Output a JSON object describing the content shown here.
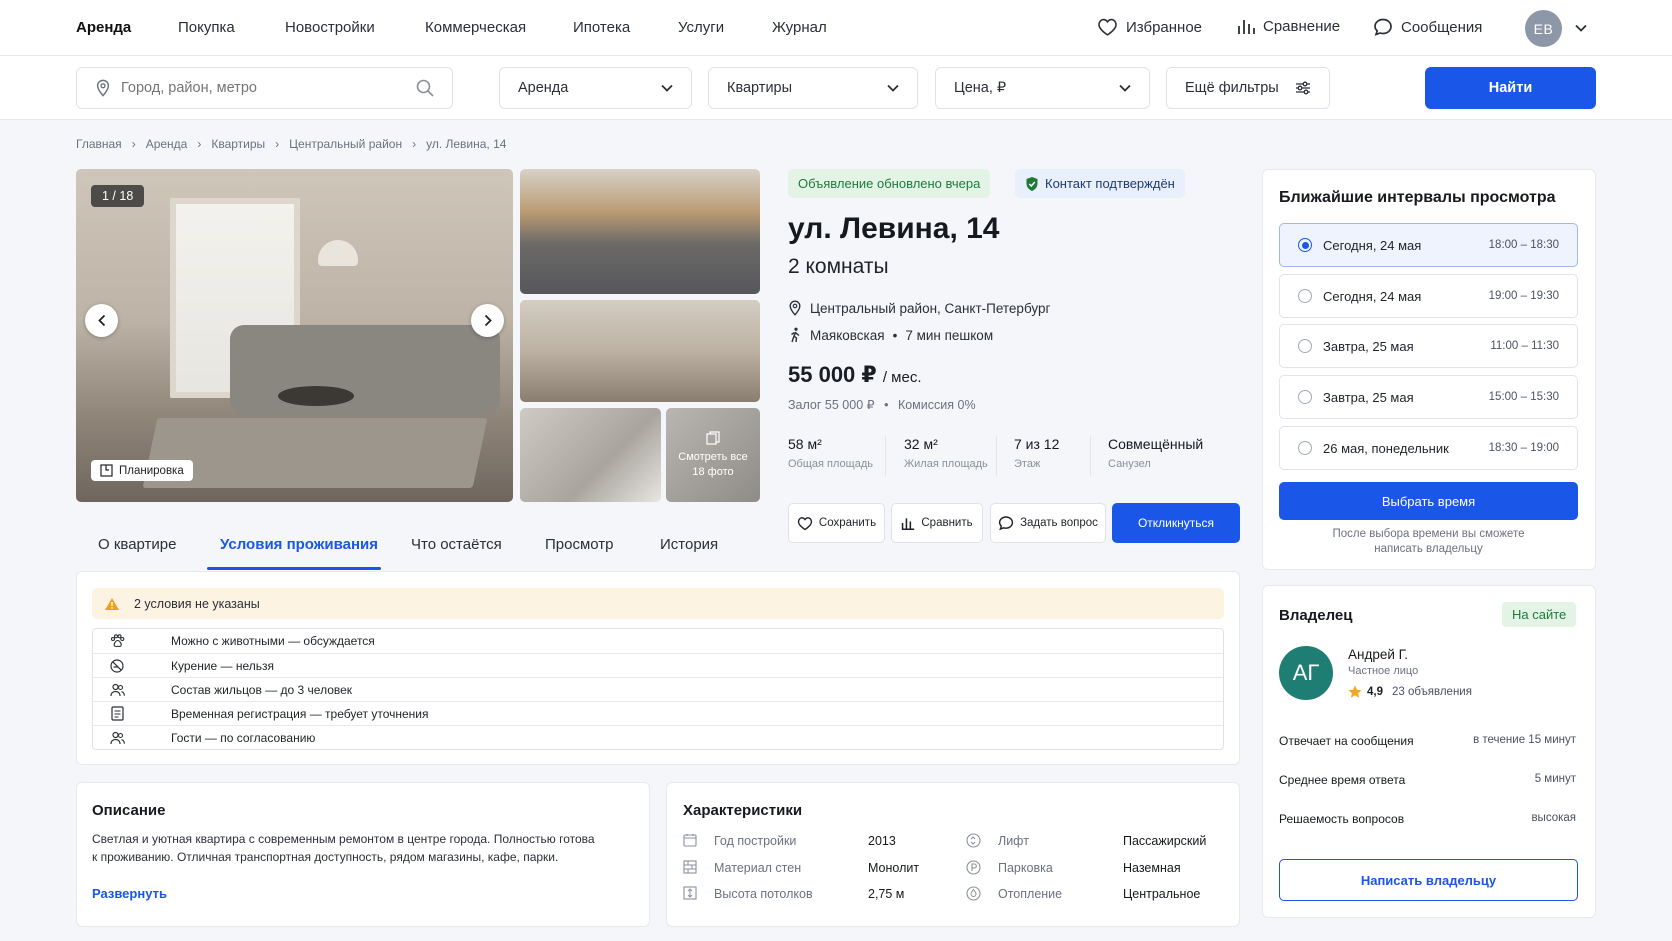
{
  "nav": {
    "items": [
      "Аренда",
      "Покупка",
      "Новостройки",
      "Коммерческая",
      "Ипотека",
      "Услуги",
      "Журнал"
    ],
    "favorites": "Избранное",
    "compare": "Сравнение",
    "messages": "Сообщения",
    "avatar": "ЕВ"
  },
  "filters": {
    "search_placeholder": "Город, район, метро",
    "deal": "Аренда",
    "type": "Квартиры",
    "price": "Цена, ₽",
    "more": "Ещё фильтры",
    "find": "Найти"
  },
  "breadcrumbs": [
    "Главная",
    "Аренда",
    "Квартиры",
    "Центральный район",
    "ул. Левина, 14"
  ],
  "gallery": {
    "counter": "1 / 18",
    "plan": "Планировка",
    "more_line1": "Смотреть все",
    "more_line2": "18 фото"
  },
  "listing": {
    "updated": "Объявление обновлено вчера",
    "verified": "Контакт подтверждён",
    "title": "ул. Левина, 14",
    "rooms": "2 комнаты",
    "district": "Центральный район, Санкт-Петербург",
    "metro": "Маяковская",
    "walk": "7 мин пешком",
    "price": "55 000 ₽",
    "per": "/ мес.",
    "deposit": "Залог 55 000 ₽",
    "commission": "Комиссия 0%",
    "specs": [
      {
        "value": "58 м²",
        "label": "Общая площадь"
      },
      {
        "value": "32 м²",
        "label": "Жилая площадь"
      },
      {
        "value": "7 из 12",
        "label": "Этаж"
      },
      {
        "value": "Совмещённый",
        "label": "Санузел"
      }
    ],
    "actions": {
      "save": "Сохранить",
      "compare": "Сравнить",
      "ask": "Задать вопрос",
      "respond": "Откликнуться"
    }
  },
  "tabs": [
    "О квартире",
    "Условия проживания",
    "Что остаётся",
    "Просмотр",
    "История"
  ],
  "conditions": {
    "warning": "2 условия не указаны",
    "rows": [
      "Можно с животными — обсуждается",
      "Курение — нельзя",
      "Состав жильцов — до 3 человек",
      "Временная регистрация — требует уточнения",
      "Гости — по согласованию"
    ]
  },
  "description": {
    "title": "Описание",
    "line1": "Светлая и уютная квартира с современным ремонтом в центре города. Полностью готова",
    "line2": "к проживанию. Отличная транспортная доступность, рядом магазины, кафе, парки.",
    "expand": "Развернуть"
  },
  "characteristics": {
    "title": "Характеристики",
    "left": [
      {
        "label": "Год постройки",
        "value": "2013"
      },
      {
        "label": "Материал стен",
        "value": "Монолит"
      },
      {
        "label": "Высота потолков",
        "value": "2,75 м"
      }
    ],
    "right": [
      {
        "label": "Лифт",
        "value": "Пассажирский"
      },
      {
        "label": "Парковка",
        "value": "Наземная"
      },
      {
        "label": "Отопление",
        "value": "Центральное"
      }
    ]
  },
  "viewing": {
    "title": "Ближайшие интервалы просмотра",
    "slots": [
      {
        "day": "Сегодня, 24 мая",
        "time": "18:00 – 18:30"
      },
      {
        "day": "Сегодня, 24 мая",
        "time": "19:00 – 19:30"
      },
      {
        "day": "Завтра, 25 мая",
        "time": "11:00 – 11:30"
      },
      {
        "day": "Завтра, 25 мая",
        "time": "15:00 – 15:30"
      },
      {
        "day": "26 мая, понедельник",
        "time": "18:30 – 19:00"
      }
    ],
    "pick": "Выбрать время",
    "hint1": "После выбора  времени вы сможете",
    "hint2": "написать владельцу"
  },
  "owner": {
    "title": "Владелец",
    "status": "На сайте",
    "initials": "АГ",
    "name": "Андрей Г.",
    "kind": "Частное лицо",
    "rating": "4,9",
    "ads": "23 объявления",
    "stats": [
      {
        "label": "Отвечает на сообщения",
        "value": "в течение 15 минут"
      },
      {
        "label": "Среднее время ответа",
        "value": "5 минут"
      },
      {
        "label": "Решаемость вопросов",
        "value": "высокая"
      }
    ],
    "write": "Написать владельцу"
  },
  "colors": {
    "accent": "#1a56e8",
    "success_bg": "#e3f4e6",
    "warning_bg": "#fdf3e3"
  }
}
